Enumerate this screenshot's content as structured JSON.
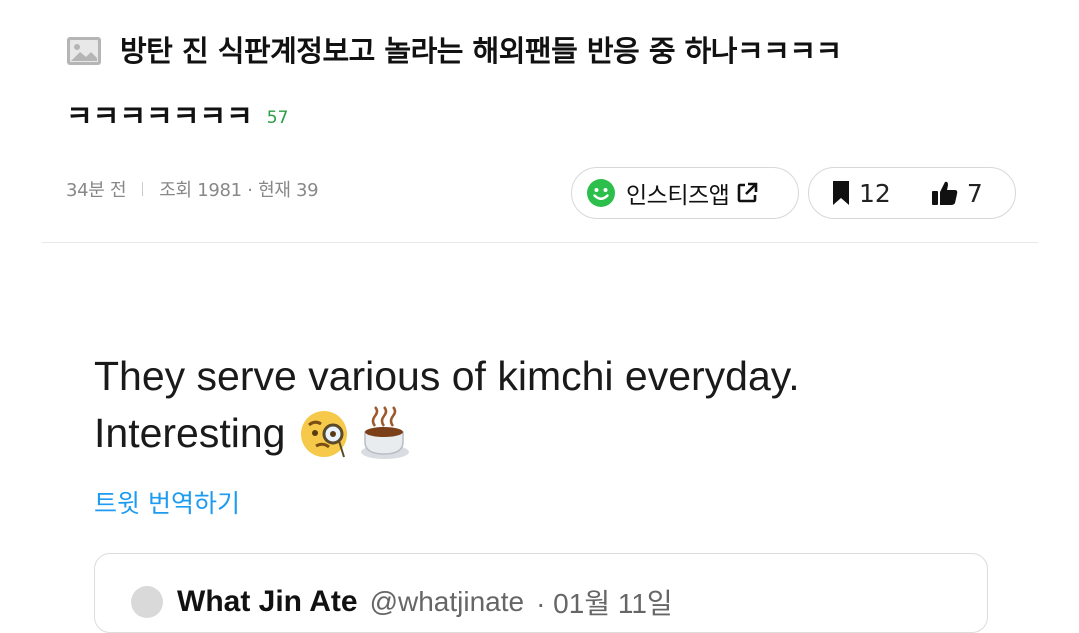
{
  "post": {
    "title_line1": "방탄 진 식판계정보고 놀라는 해외팬들 반응 중 하나ㅋㅋㅋㅋ",
    "title_line2": "ㅋㅋㅋㅋㅋㅋㅋ",
    "comment_count": "57",
    "time_ago": "34분 전",
    "views": "조회 1981 · 현재 39",
    "app_label": "인스티즈앱",
    "bookmark_count": "12",
    "like_count": "7"
  },
  "tweet": {
    "text_line1": "They serve various of kimchi everyday.",
    "text_line2": "Interesting",
    "translate_label": "트윗 번역하기"
  },
  "quote": {
    "name": "What Jin Ate",
    "handle": "@whatjinate",
    "date": "· 01월 11일"
  },
  "colors": {
    "accent_green": "#2a9d45",
    "twitter_blue": "#1d9bf0"
  },
  "icons": [
    "image-icon",
    "smile-icon",
    "external-link-icon",
    "bookmark-icon",
    "thumbs-up-icon",
    "monocle-face-emoji",
    "hot-beverage-emoji"
  ]
}
